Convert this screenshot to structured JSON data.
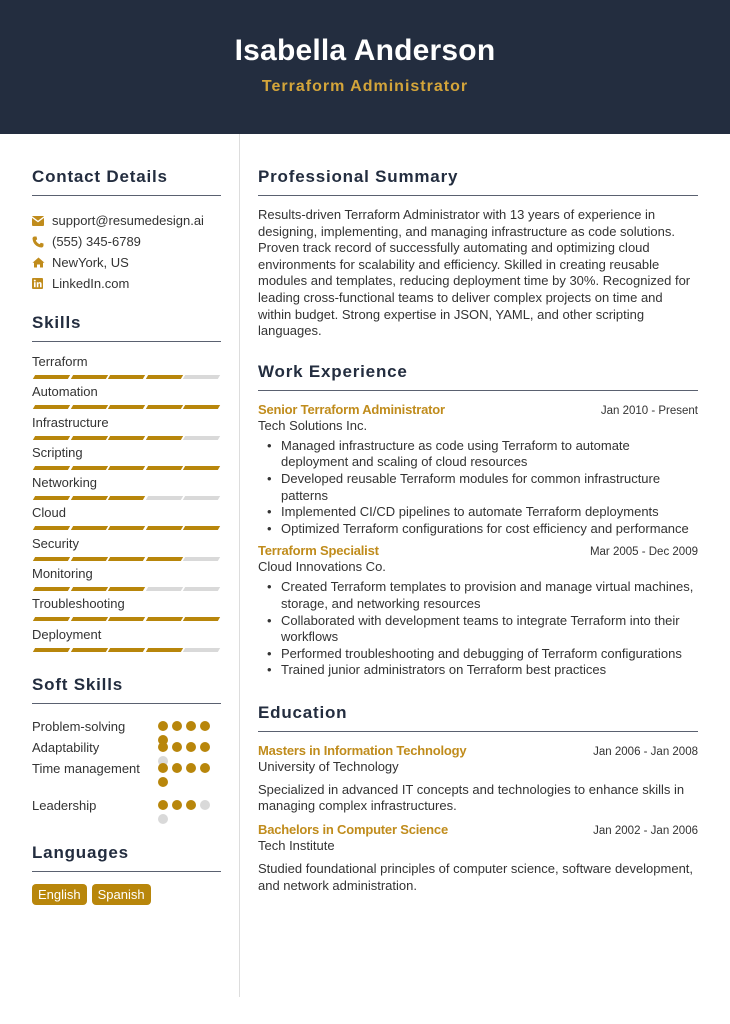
{
  "header": {
    "name": "Isabella Anderson",
    "title": "Terraform Administrator"
  },
  "colors": {
    "header_bg": "#232d3f",
    "accent": "#b8860b",
    "title_gold": "#d4a53a",
    "inactive": "#d9d9d9"
  },
  "contact": {
    "heading": "Contact Details",
    "items": [
      {
        "icon": "envelope-icon",
        "text": "support@resumedesign.ai"
      },
      {
        "icon": "phone-icon",
        "text": "(555) 345-6789"
      },
      {
        "icon": "home-icon",
        "text": "NewYork, US"
      },
      {
        "icon": "linkedin-icon",
        "text": "LinkedIn.com"
      }
    ]
  },
  "skills": {
    "heading": "Skills",
    "max": 5,
    "items": [
      {
        "name": "Terraform",
        "level": 4
      },
      {
        "name": "Automation",
        "level": 5
      },
      {
        "name": "Infrastructure",
        "level": 4
      },
      {
        "name": "Scripting",
        "level": 5
      },
      {
        "name": "Networking",
        "level": 3
      },
      {
        "name": "Cloud",
        "level": 5
      },
      {
        "name": "Security",
        "level": 4
      },
      {
        "name": "Monitoring",
        "level": 3
      },
      {
        "name": "Troubleshooting",
        "level": 5
      },
      {
        "name": "Deployment",
        "level": 4
      }
    ]
  },
  "soft_skills": {
    "heading": "Soft Skills",
    "max": 5,
    "items": [
      {
        "name": "Problem-solving",
        "level": 5
      },
      {
        "name": "Adaptability",
        "level": 4
      },
      {
        "name": "Time management",
        "level": 5
      },
      {
        "name": "Leadership",
        "level": 3
      }
    ]
  },
  "languages": {
    "heading": "Languages",
    "items": [
      "English",
      "Spanish"
    ]
  },
  "summary": {
    "heading": "Professional Summary",
    "text": "Results-driven Terraform Administrator with 13 years of experience in designing, implementing, and managing infrastructure as code solutions. Proven track record of successfully automating and optimizing cloud environments for scalability and efficiency. Skilled in creating reusable modules and templates, reducing deployment time by 30%. Recognized for leading cross-functional teams to deliver complex projects on time and within budget. Strong expertise in JSON, YAML, and other scripting languages."
  },
  "work": {
    "heading": "Work Experience",
    "jobs": [
      {
        "title": "Senior Terraform Administrator",
        "date": "Jan 2010 - Present",
        "company": "Tech Solutions Inc.",
        "bullets": [
          "Managed infrastructure as code using Terraform to automate deployment and scaling of cloud resources",
          "Developed reusable Terraform modules for common infrastructure patterns",
          "Implemented CI/CD pipelines to automate Terraform deployments",
          "Optimized Terraform configurations for cost efficiency and performance"
        ]
      },
      {
        "title": "Terraform Specialist",
        "date": "Mar 2005 - Dec 2009",
        "company": "Cloud Innovations Co.",
        "bullets": [
          "Created Terraform templates to provision and manage virtual machines, storage, and networking resources",
          "Collaborated with development teams to integrate Terraform into their workflows",
          "Performed troubleshooting and debugging of Terraform configurations",
          "Trained junior administrators on Terraform best practices"
        ]
      }
    ]
  },
  "education": {
    "heading": "Education",
    "items": [
      {
        "degree": "Masters in Information Technology",
        "date": "Jan 2006 - Jan 2008",
        "school": "University of Technology",
        "description": "Specialized in advanced IT concepts and technologies to enhance skills in managing complex infrastructures."
      },
      {
        "degree": "Bachelors in Computer Science",
        "date": "Jan 2002 - Jan 2006",
        "school": "Tech Institute",
        "description": "Studied foundational principles of computer science, software development, and network administration."
      }
    ]
  }
}
